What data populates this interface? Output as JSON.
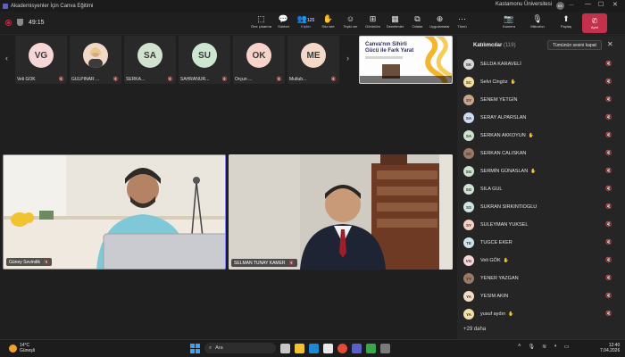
{
  "window": {
    "title": "Akademisyenler İçin Canva Eğitimi",
    "org": "Kastamonu Üniversitesi",
    "account_initials": "KK",
    "more": "...",
    "minimize": "—",
    "maximize": "☐",
    "close": "✕"
  },
  "toolbar": {
    "timer": "49:15",
    "items": [
      {
        "label": "Öne çıkarma",
        "icon": "⬚"
      },
      {
        "label": "Sohbet",
        "icon": "💬"
      },
      {
        "label": "Kişiler",
        "icon": "👥",
        "count": "125"
      },
      {
        "label": "Söz iste",
        "icon": "✋"
      },
      {
        "label": "Tepki ver",
        "icon": "☺"
      },
      {
        "label": "Görünüm",
        "icon": "⊞"
      },
      {
        "label": "Denetimler",
        "icon": "▦"
      },
      {
        "label": "Odalar",
        "icon": "⧉"
      },
      {
        "label": "Uygulamalar",
        "icon": "⊕"
      },
      {
        "label": "Tümü",
        "icon": "⋯"
      }
    ],
    "camera": {
      "label": "Kamera",
      "icon": "📷"
    },
    "mic": {
      "label": "Mikrofon",
      "icon": "🎙"
    },
    "share": {
      "label": "Paylaş",
      "icon": "⬆"
    },
    "leave": {
      "label": "Ayrıl",
      "icon": "✆"
    }
  },
  "gallery": {
    "prev": "‹",
    "next": "›",
    "tiles": [
      {
        "initials": "VG",
        "name": "Veli GÖK",
        "color": "#f6d6d6",
        "photo": false
      },
      {
        "initials": "",
        "name": "GULPINAR ...",
        "color": "#f2d9c7",
        "photo": true
      },
      {
        "initials": "SA",
        "name": "SERKA...",
        "color": "#cfe3cf",
        "photo": false
      },
      {
        "initials": "SU",
        "name": "SAHRANUR...",
        "color": "#cde6d0",
        "photo": false
      },
      {
        "initials": "OK",
        "name": "Orçun ...",
        "color": "#f7d3c9",
        "photo": false
      },
      {
        "initials": "ME",
        "name": "Mutlub...",
        "color": "#f4d8c8",
        "photo": false
      }
    ],
    "share_title": "Canva'nın Sihirli Gücü ile Fark Yarat"
  },
  "videos": [
    {
      "name": "Güney Sevindik"
    },
    {
      "name": "SELMAN TUNAY KAMER"
    }
  ],
  "panel": {
    "title": "Katılımcılar",
    "count": "(119)",
    "mute_all": "Tümünün sesini kapat",
    "close": "✕",
    "participants": [
      {
        "initials": "SK",
        "name": "SELDA KARAVELİ",
        "color": "#d8d8d8",
        "hand": false
      },
      {
        "initials": "SC",
        "name": "Selvi Cingöz",
        "color": "#f3e0a8",
        "hand": true
      },
      {
        "initials": "SY",
        "name": "SENEM YETGİN",
        "color": "#c9a58b",
        "hand": false
      },
      {
        "initials": "SA",
        "name": "SERAY ALPARSLAN",
        "color": "#cfdcf3",
        "hand": false
      },
      {
        "initials": "SA",
        "name": "SERKAN AKKOYUN",
        "color": "#cfe3cf",
        "hand": true
      },
      {
        "initials": "SC",
        "name": "SERKAN CALISKAN",
        "color": "#9a7a66",
        "hand": false
      },
      {
        "initials": "SG",
        "name": "SERMİN GÜNASLAN",
        "color": "#cfe3cf",
        "hand": true
      },
      {
        "initials": "SG",
        "name": "SILA GUL",
        "color": "#d4e4d4",
        "hand": false
      },
      {
        "initials": "SS",
        "name": "SUKRAN SIRKINTIOGLU",
        "color": "#cde6e6",
        "hand": false
      },
      {
        "initials": "SY",
        "name": "SULEYMAN YUKSEL",
        "color": "#f7d0c4",
        "hand": false
      },
      {
        "initials": "TE",
        "name": "TUGCE EKER",
        "color": "#cfe3ec",
        "hand": false
      },
      {
        "initials": "VG",
        "name": "Veli GÖK",
        "color": "#f6d6d6",
        "hand": true
      },
      {
        "initials": "YY",
        "name": "YENER YAZGAN",
        "color": "#9a7a66",
        "hand": false
      },
      {
        "initials": "YA",
        "name": "YESIM AKIN",
        "color": "#f4ddc6",
        "hand": false
      },
      {
        "initials": "YA",
        "name": "yusuf aydın",
        "color": "#f3e0a8",
        "hand": true
      }
    ],
    "more": "+29 daha"
  },
  "taskbar": {
    "temp": "14°C",
    "weather": "Güneşli",
    "search": "Ara",
    "time": "12:40",
    "date": "7.04.2026"
  }
}
